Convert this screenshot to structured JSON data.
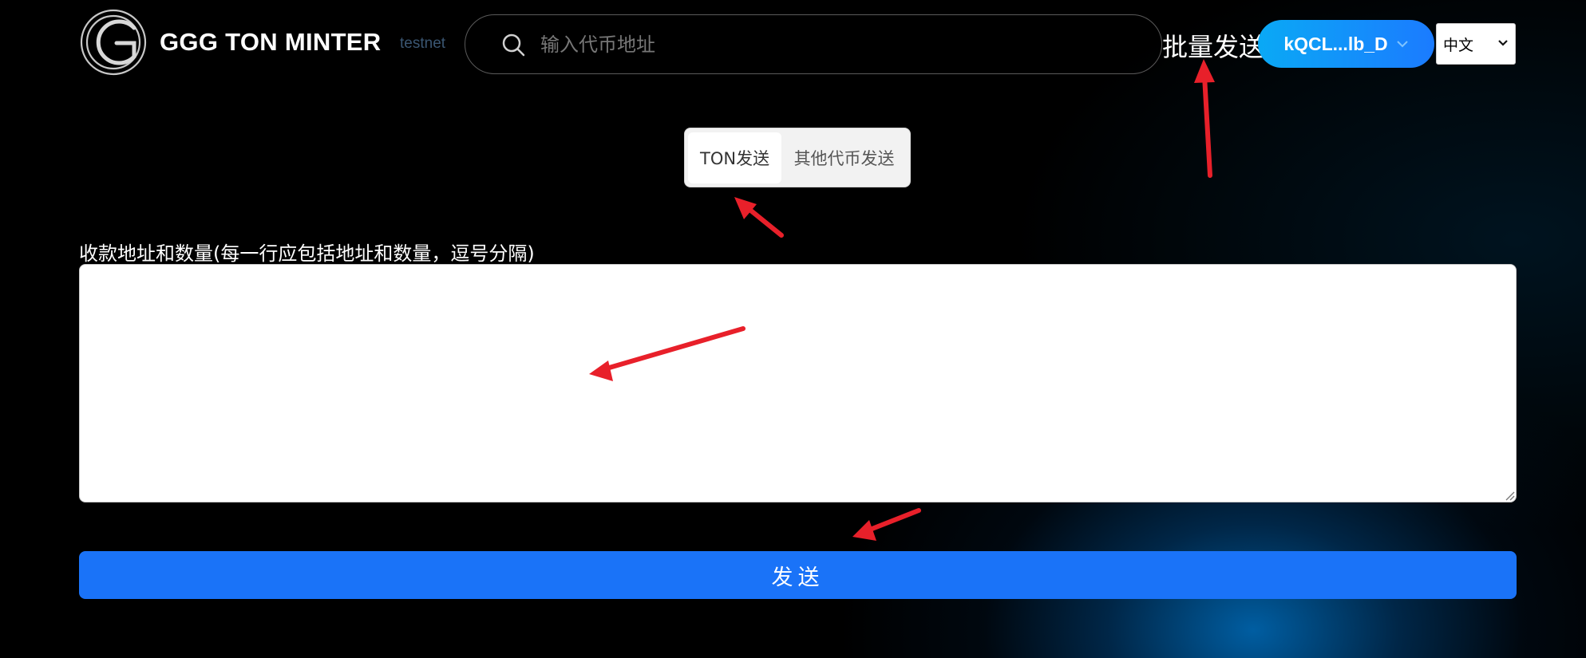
{
  "header": {
    "logo_text": "GGG TON MINTER",
    "network_badge": "testnet",
    "search_placeholder": "输入代币地址",
    "batch_send_link": "批量发送",
    "wallet_address": "kQCL...lb_D",
    "language": "中文"
  },
  "tabs": [
    {
      "label": "TON发送",
      "active": true
    },
    {
      "label": "其他代币发送",
      "active": false
    }
  ],
  "form": {
    "recipients_label": "收款地址和数量(每一行应包括地址和数量，逗号分隔)",
    "recipients_value": "",
    "send_button": "发送"
  },
  "colors": {
    "background": "#000000",
    "accent": "#1a73f8",
    "wallet_gradient": [
      "#0aa9f5",
      "#1b7bff"
    ],
    "annotation_arrow": "#e8202a"
  },
  "icons": {
    "logo": "ggg-logo-icon",
    "search": "search-icon",
    "wallet_chevron": "chevron-down-icon",
    "language_caret": "caret-down-icon"
  }
}
